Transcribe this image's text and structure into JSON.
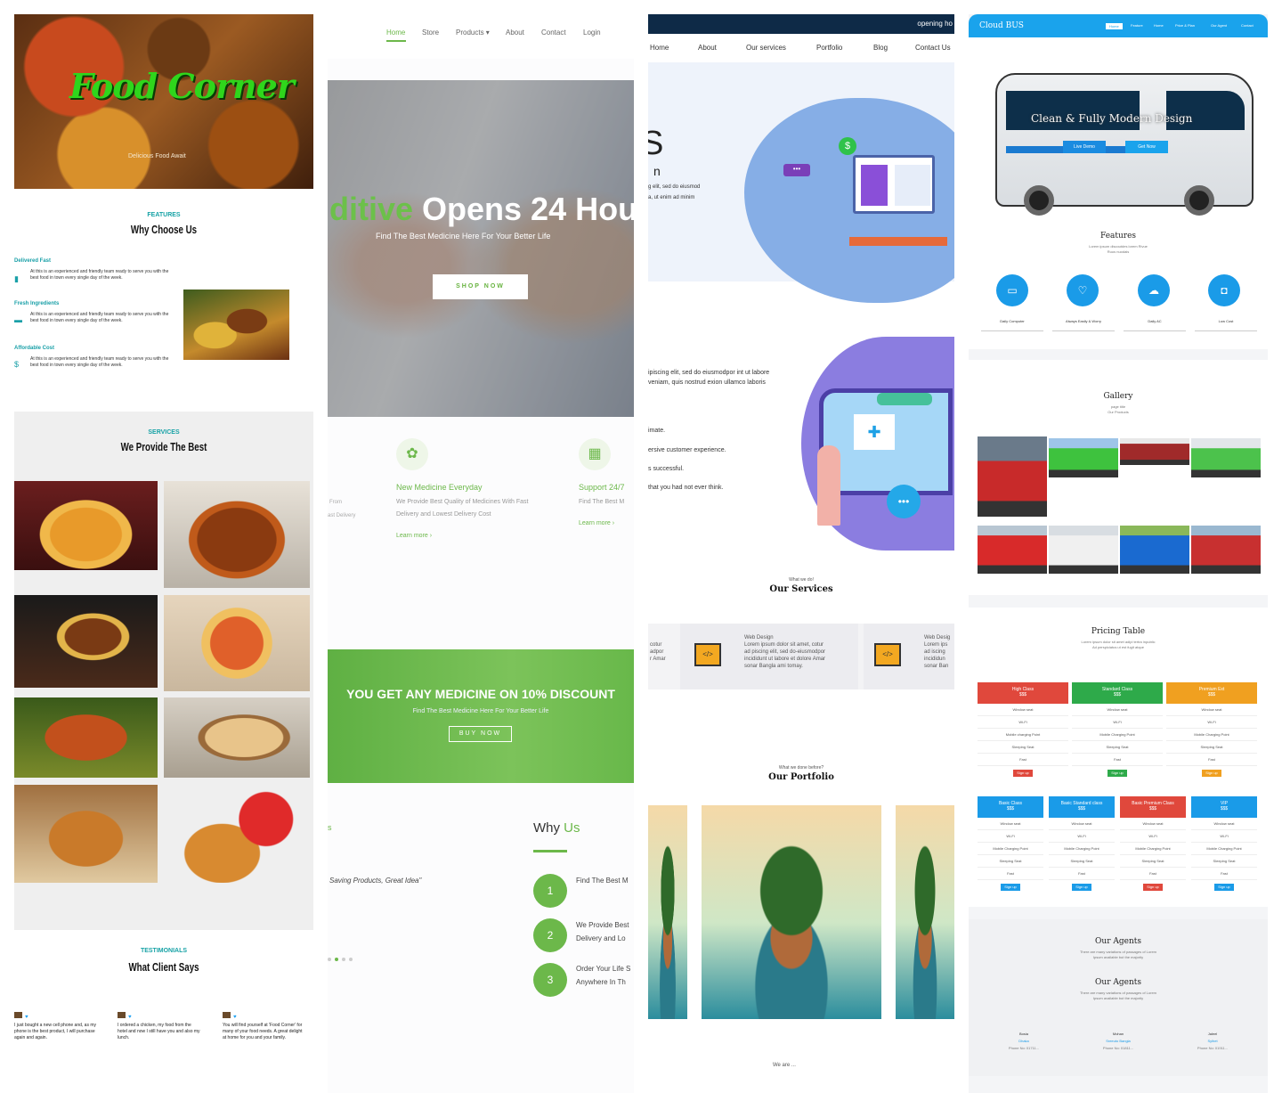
{
  "col1": {
    "brand": "Food Corner",
    "hero_sub": "Delicious Food Await",
    "why_kicker": "FEATURES",
    "why_title": "Why Choose Us",
    "features": [
      {
        "title": "Delivered Fast",
        "icon": "phone-icon",
        "text": "At this is an experienced and friendly team ready to serve you with the best food in town every single day of the week."
      },
      {
        "title": "Fresh Ingredients",
        "icon": "card-icon",
        "text": "At this is an experienced and friendly team ready to serve you with the best food in town every single day of the week."
      },
      {
        "title": "Affordable Cost",
        "icon": "dollar-icon",
        "text": "At this is an experienced and friendly team ready to serve you with the best food in town every single day of the week."
      }
    ],
    "provide_kicker": "SERVICES",
    "provide_title": "We Provide The Best",
    "testi_kicker": "TESTIMONIALS",
    "testi_title": "What Client Says",
    "testimonials": [
      {
        "text": "I just bought a new cell phone and, as my phone is the best product, I will purchase again and again."
      },
      {
        "text": "I ordered a chicken, my food from the hotel and now I still have you and also my lunch."
      },
      {
        "text": "You will find yourself at 'Food Corner' for many of your food needs. A great delight at home for you and your family."
      }
    ]
  },
  "col2": {
    "nav": [
      "Home",
      "Store",
      "Products ▾",
      "About",
      "Contact",
      "Login"
    ],
    "hero_title_a": "ditive",
    "hero_title_b": " Opens 24 Hou",
    "hero_sub": "Find The Best Medicine Here For Your Better Life",
    "shop_btn": "SHOP NOW",
    "services": [
      {
        "title": "New Medicine Everyday",
        "line1": "We Provide Best Quality of Medicines With Fast",
        "line2": "Delivery and Lowest Delivery Cost",
        "link": "Learn more  ›"
      },
      {
        "title": "Support 24/7",
        "line1": "Find The Best M",
        "line2": "",
        "link": "Learn more  ›"
      }
    ],
    "left_frag1": "From",
    "left_frag2": "ast Delivery",
    "banner_title": "YOU GET ANY MEDICINE ON 10% DISCOUNT",
    "banner_sub": "Find The Best Medicine Here For Your Better Life",
    "buy_btn": "BUY NOW",
    "left_s": "s",
    "quote": "Saving Products, Great Idea\"",
    "why_a": "Why ",
    "why_b": "Us",
    "why_items": [
      {
        "n": "1",
        "l1": "Find The Best M",
        "l2": ""
      },
      {
        "n": "2",
        "l1": "We Provide Best",
        "l2": "Delivery and Lo"
      },
      {
        "n": "3",
        "l1": "Order Your Life S",
        "l2": "Anywhere In Th"
      }
    ]
  },
  "col3": {
    "topbar": "opening ho",
    "nav": [
      "Home",
      "About",
      "Our services",
      "Portfolio",
      "Blog",
      "Contact Us"
    ],
    "hero_big": "S",
    "hero_n": "n",
    "hero_p1": "g elit, sed do eiusmod",
    "hero_p2": "a, ut enim ad minim",
    "about_p1": "ipiscing elit, sed do eiusmodpor int ut labore",
    "about_p2": "veniam, quis nostrud exion ullamco laboris",
    "bullets": [
      "imate.",
      "ersive customer experience.",
      "s successful.",
      "that you had not ever think."
    ],
    "svc_kicker": "What we do!",
    "svc_title": "Our Services",
    "svc_left": [
      "cotur",
      "adpor",
      "r Amar"
    ],
    "svc_card": {
      "title": "Web Design",
      "l1": "Lorem ipsum dolor sit amet, cotur",
      "l2": "ad piscing elit, sed do-eiusmodpor",
      "l3": "incididunt ut labore et dolore Amar",
      "l4": "sonar Bangla ami tomay."
    },
    "svc_right": [
      "Web Desig",
      "Lorem ips",
      "ad iscing",
      "incididun",
      "sonar Ban"
    ],
    "port_kicker": "What we done before?",
    "port_title": "Our Portfolio",
    "bottom_frag": "We are ..."
  },
  "col4": {
    "brand": "Cloud BUS",
    "nav": [
      "Home",
      "Feature",
      "Home",
      "Price & Plan",
      "Our Agent",
      "Contact"
    ],
    "hero_title": "Clean & Fully Modern Design",
    "btn_a": "Live Demo",
    "btn_b": "Get Now",
    "features_h": "Features",
    "features_s1": "Lorem ipsum discoutdes lorem Rivue",
    "features_s2": "Ruus nuodais",
    "features": [
      {
        "label": "Daily Computer",
        "icon": "bus-icon"
      },
      {
        "label": "Always Easily & Worry",
        "icon": "heart-icon"
      },
      {
        "label": "Daily AC",
        "icon": "cloud-icon"
      },
      {
        "label": "Low Cost",
        "icon": "camera-icon"
      }
    ],
    "gallery_h": "Gallery",
    "gallery_s1": "page title",
    "gallery_s2": "Our Products",
    "pricing_h": "Pricing Table",
    "pricing_s1": "Lorem ipsum dolor sit amet adipi tertra inpublic",
    "pricing_s2": "Ad perspiciatus ut est fugit atque",
    "plans_top": [
      {
        "name": "High Class",
        "price": "$$$",
        "color": "#e0483c",
        "rows": [
          "Window seat",
          "Wi-Fi",
          "Mobile charging Point",
          "Sleeping Seat",
          "Fast"
        ],
        "btn": "Sign up"
      },
      {
        "name": "Standard Class",
        "price": "$$$",
        "color": "#2eaa4a",
        "rows": [
          "Window seat",
          "Wi-Fi",
          "Mobile Charging Point",
          "Sleeping Seat",
          "Fast"
        ],
        "btn": "Sign up"
      },
      {
        "name": "Premium Ext",
        "price": "$$$",
        "color": "#f0a020",
        "rows": [
          "Window seat",
          "Wi-Fi",
          "Mobile Charging Point",
          "Sleeping Seat",
          "Fast"
        ],
        "btn": "Sign up"
      }
    ],
    "plans_bottom": [
      {
        "name": "Basic Class",
        "price": "$$$",
        "color": "#1a9be8",
        "rows": [
          "Window seat",
          "Wi-Fi",
          "Mobile Charging Point",
          "Sleeping Seat",
          "Fast"
        ],
        "btn": "Sign up"
      },
      {
        "name": "Basic Standard class",
        "price": "$$$",
        "color": "#1a9be8",
        "rows": [
          "Window seat",
          "Wi-Fi",
          "Mobile Charging Point",
          "Sleeping Seat",
          "Fast"
        ],
        "btn": "Sign up"
      },
      {
        "name": "Basic Premium Class",
        "price": "$$$",
        "color": "#e0483c",
        "rows": [
          "Window seat",
          "Wi-Fi",
          "Mobile Charging Point",
          "Sleeping Seat",
          "Fast"
        ],
        "btn": "Sign up"
      },
      {
        "name": "VIP",
        "price": "$$$",
        "color": "#1a9be8",
        "rows": [
          "Window seat",
          "Wi-Fi",
          "Mobile Charging Point",
          "Sleeping Seat",
          "Fast"
        ],
        "btn": "Sign up"
      }
    ],
    "agents_h": "Our Agents",
    "agents_s1": "There are many variations of passages of Lorem",
    "agents_s2": "Ipsum available but the majority",
    "agents": [
      {
        "name": "Bosia",
        "place": "Dhaka",
        "phone": "Phone No: 01711..."
      },
      {
        "name": "Mohan",
        "place": "Sreeuto Bangla",
        "phone": "Phone No: 01811..."
      },
      {
        "name": "Jaleel",
        "place": "Sylhet",
        "phone": "Phone No: 01911..."
      }
    ]
  }
}
